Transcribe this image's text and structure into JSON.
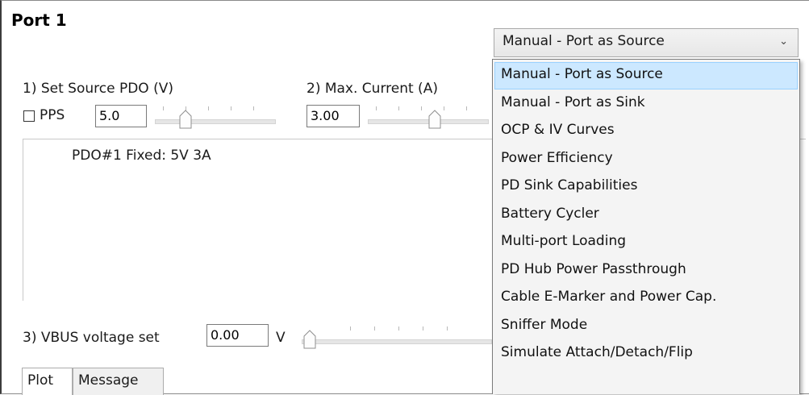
{
  "port": {
    "title": "Port 1"
  },
  "source_pdo": {
    "label": "1) Set Source PDO (V)",
    "pps_label": "PPS",
    "pps_checked": false,
    "value": "5.0"
  },
  "max_current": {
    "label": "2) Max. Current (A)",
    "value": "3.00"
  },
  "pdo_list": {
    "items": [
      "PDO#1 Fixed: 5V 3A"
    ]
  },
  "vbus": {
    "label": "3) VBUS voltage set",
    "value": "0.00",
    "unit": "V"
  },
  "tabs": [
    {
      "label": "Plot",
      "active": true
    },
    {
      "label": "Message",
      "active": false
    }
  ],
  "mode_select": {
    "value": "Manual - Port as Source",
    "arrow": "⌄",
    "options": [
      "Manual - Port as Source",
      "Manual - Port as Sink",
      "OCP & IV Curves",
      "Power Efficiency",
      "PD Sink Capabilities",
      "Battery Cycler",
      "Multi-port Loading",
      "PD Hub Power Passthrough",
      "Cable E-Marker and Power Cap.",
      "Sniffer Mode",
      "Simulate Attach/Detach/Flip"
    ],
    "selected_index": 0
  },
  "colors": {
    "selection_bg": "#cce8ff",
    "selection_border": "#99d1ff",
    "dropdown_bg": "#f4f4f4"
  }
}
